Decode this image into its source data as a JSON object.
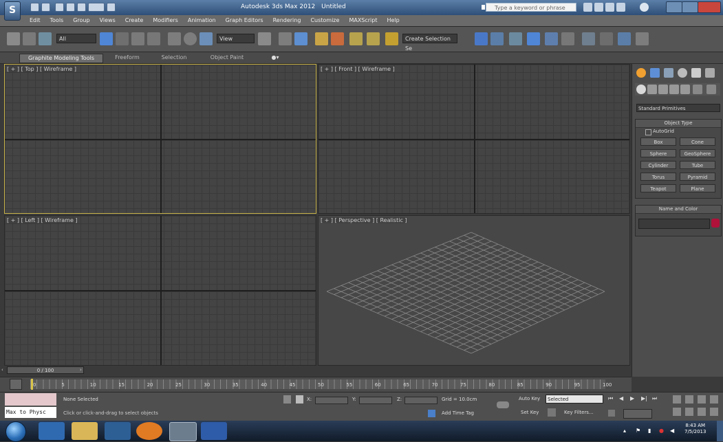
{
  "title_bar": {
    "title": "Autodesk 3ds Max 2012",
    "document": "Untitled",
    "search_placeholder": "Type a keyword or phrase"
  },
  "menu": [
    "Edit",
    "Tools",
    "Group",
    "Views",
    "Create",
    "Modifiers",
    "Animation",
    "Graph Editors",
    "Rendering",
    "Customize",
    "MAXScript",
    "Help"
  ],
  "toolbar": {
    "filter_value": "All",
    "refcoord_value": "View",
    "selection_set_value": "Create Selection Se"
  },
  "ribbon": {
    "tabs": [
      "Graphite Modeling Tools",
      "Freeform",
      "Selection",
      "Object Paint"
    ]
  },
  "viewports": {
    "top": "[ + ] [ Top ] [ Wireframe ]",
    "front": "[ + ] [ Front ] [ Wireframe ]",
    "left": "[ + ] [ Left ] [ Wireframe ]",
    "perspective": "[ + ] [ Perspective ] [ Realistic ]"
  },
  "command_panel": {
    "dropdown": "Standard Primitives",
    "object_type_title": "Object Type",
    "autogrid": "AutoGrid",
    "buttons": [
      "Box",
      "Cone",
      "Sphere",
      "GeoSphere",
      "Cylinder",
      "Tube",
      "Torus",
      "Pyramid",
      "Teapot",
      "Plane"
    ],
    "name_color_title": "Name and Color"
  },
  "timeline": {
    "slider": "0 / 100",
    "ticks": [
      "0",
      "5",
      "10",
      "15",
      "20",
      "25",
      "30",
      "35",
      "40",
      "45",
      "50",
      "55",
      "60",
      "65",
      "70",
      "75",
      "80",
      "85",
      "90",
      "95",
      "100"
    ]
  },
  "status": {
    "maxscript_input": "Max to Physc",
    "selection": "None Selected",
    "prompt": "Click or click-and-drag to select objects",
    "grid": "Grid = 10.0cm",
    "add_time_tag": "Add Time Tag",
    "auto_key": "Auto Key",
    "set_key": "Set Key",
    "selected": "Selected",
    "key_filters": "Key Filters..."
  },
  "clock": {
    "time": "8:43 AM",
    "date": "7/5/2013"
  }
}
